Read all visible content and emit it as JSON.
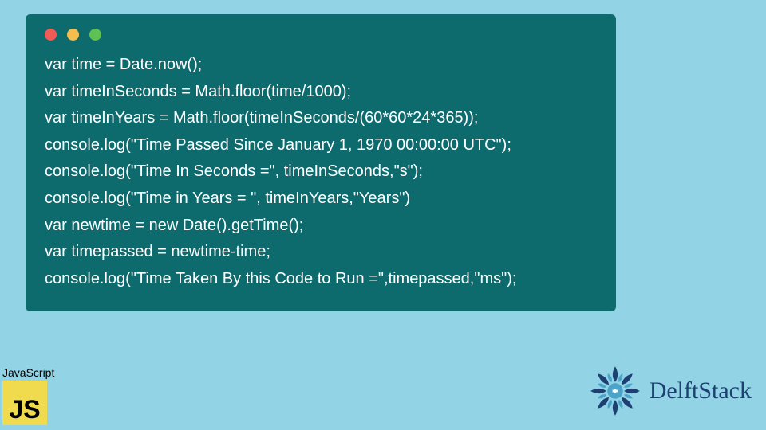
{
  "code": {
    "lines": [
      "var time = Date.now();",
      "var timeInSeconds = Math.floor(time/1000);",
      "var timeInYears = Math.floor(timeInSeconds/(60*60*24*365));",
      "console.log(\"Time Passed Since January 1, 1970 00:00:00 UTC\");",
      "console.log(\"Time In Seconds =\", timeInSeconds,\"s\");",
      "console.log(\"Time in Years = \", timeInYears,\"Years\")",
      "var newtime = new Date().getTime();",
      "var timepassed = newtime-time;",
      "console.log(\"Time Taken By this Code to Run =\",timepassed,\"ms\");"
    ]
  },
  "badge": {
    "language_label": "JavaScript",
    "language_short": "JS"
  },
  "brand": {
    "name": "DelftStack"
  }
}
